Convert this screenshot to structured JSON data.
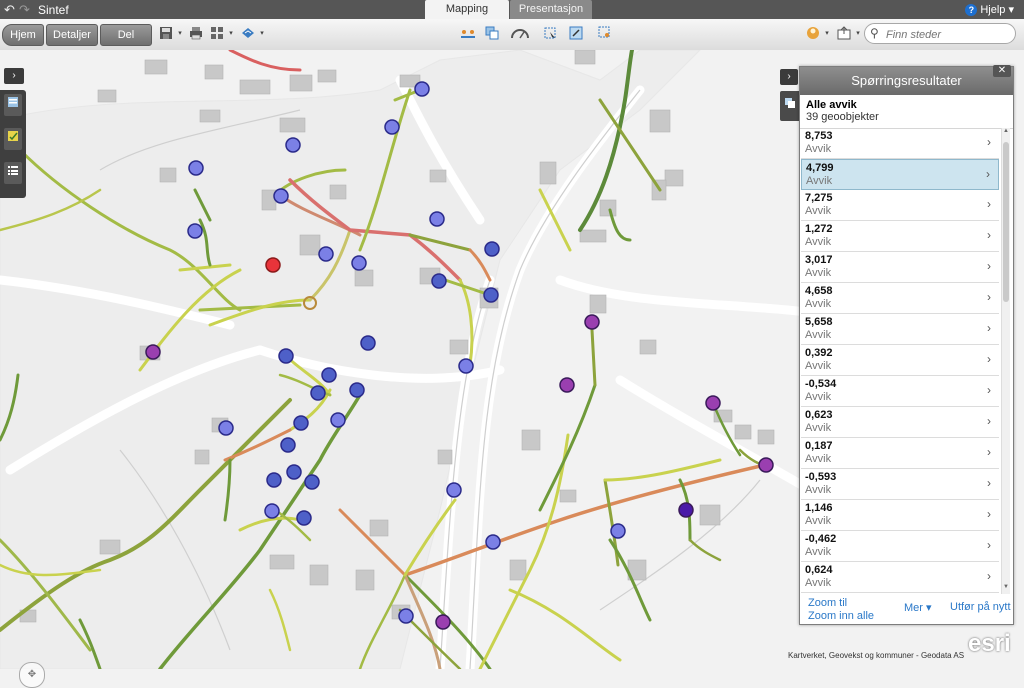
{
  "titlebar": {
    "undo_icon": "undo-icon",
    "redo_icon": "redo-icon",
    "title": "Sintef",
    "help_label": "Hjelp"
  },
  "tabs": [
    {
      "label": "Mapping"
    },
    {
      "label": "Presentasjon"
    }
  ],
  "toolbar": {
    "home_label": "Hjem",
    "details_label": "Detaljer",
    "share_label": "Del"
  },
  "search": {
    "placeholder": "Finn steder"
  },
  "results_panel": {
    "title": "Spørringsresultater",
    "heading": "Alle avvik",
    "count": "39 geoobjekter",
    "items": [
      {
        "value": "8,753",
        "label": "Avvik"
      },
      {
        "value": "4,799",
        "label": "Avvik"
      },
      {
        "value": "7,275",
        "label": "Avvik"
      },
      {
        "value": "1,272",
        "label": "Avvik"
      },
      {
        "value": "3,017",
        "label": "Avvik"
      },
      {
        "value": "4,658",
        "label": "Avvik"
      },
      {
        "value": "5,658",
        "label": "Avvik"
      },
      {
        "value": "0,392",
        "label": "Avvik"
      },
      {
        "value": "-0,534",
        "label": "Avvik"
      },
      {
        "value": "0,623",
        "label": "Avvik"
      },
      {
        "value": "0,187",
        "label": "Avvik"
      },
      {
        "value": "-0,593",
        "label": "Avvik"
      },
      {
        "value": "1,146",
        "label": "Avvik"
      },
      {
        "value": "-0,462",
        "label": "Avvik"
      },
      {
        "value": "0,624",
        "label": "Avvik"
      }
    ],
    "selected_index": 1,
    "zoom_to": "Zoom til",
    "zoom_all": "Zoom inn alle",
    "more": "Mer",
    "run_again": "Utfør på nytt"
  },
  "attribution": "Kartverket, Geovekst og kommuner - Geodata AS",
  "esri_logo": "esri",
  "colors": {
    "point_blue": "#6f73e0",
    "point_red": "#e8343a",
    "point_purple": "#8a3aa8",
    "pipe_red": "#d94b4b",
    "pipe_orange": "#d98a5a",
    "pipe_green": "#5c8a3a",
    "pipe_yellow": "#cfd653"
  }
}
